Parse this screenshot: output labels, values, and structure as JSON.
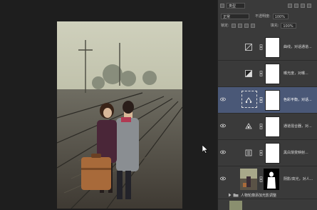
{
  "panel": {
    "filter_label": "类型",
    "blend_mode": "正常",
    "opacity_label": "不透明度:",
    "opacity_value": "100%",
    "lock_label": "锁定:",
    "fill_label": "填充:",
    "fill_value": "100%"
  },
  "layers": [
    {
      "name": "曲线，对话通道...",
      "icon": "curves-icon"
    },
    {
      "name": "曝光度，对曝...",
      "icon": "exposure-icon"
    },
    {
      "name": "色彩平衡，对话...",
      "icon": "color-balance-icon",
      "selected": true
    },
    {
      "name": "通道混合器，对...",
      "icon": "channel-mixer-icon"
    },
    {
      "name": "黑白渐变映射...",
      "icon": "gradient-map-icon"
    },
    {
      "name": "阴影/高光，对人...",
      "icon": "photo-thumb"
    }
  ],
  "group": {
    "name": "人物轮廓添加光影调整"
  },
  "colors": {
    "panel_bg": "#3a3a3a",
    "selected_layer": "#4a5877",
    "canvas_bg": "#1e1e1e"
  }
}
